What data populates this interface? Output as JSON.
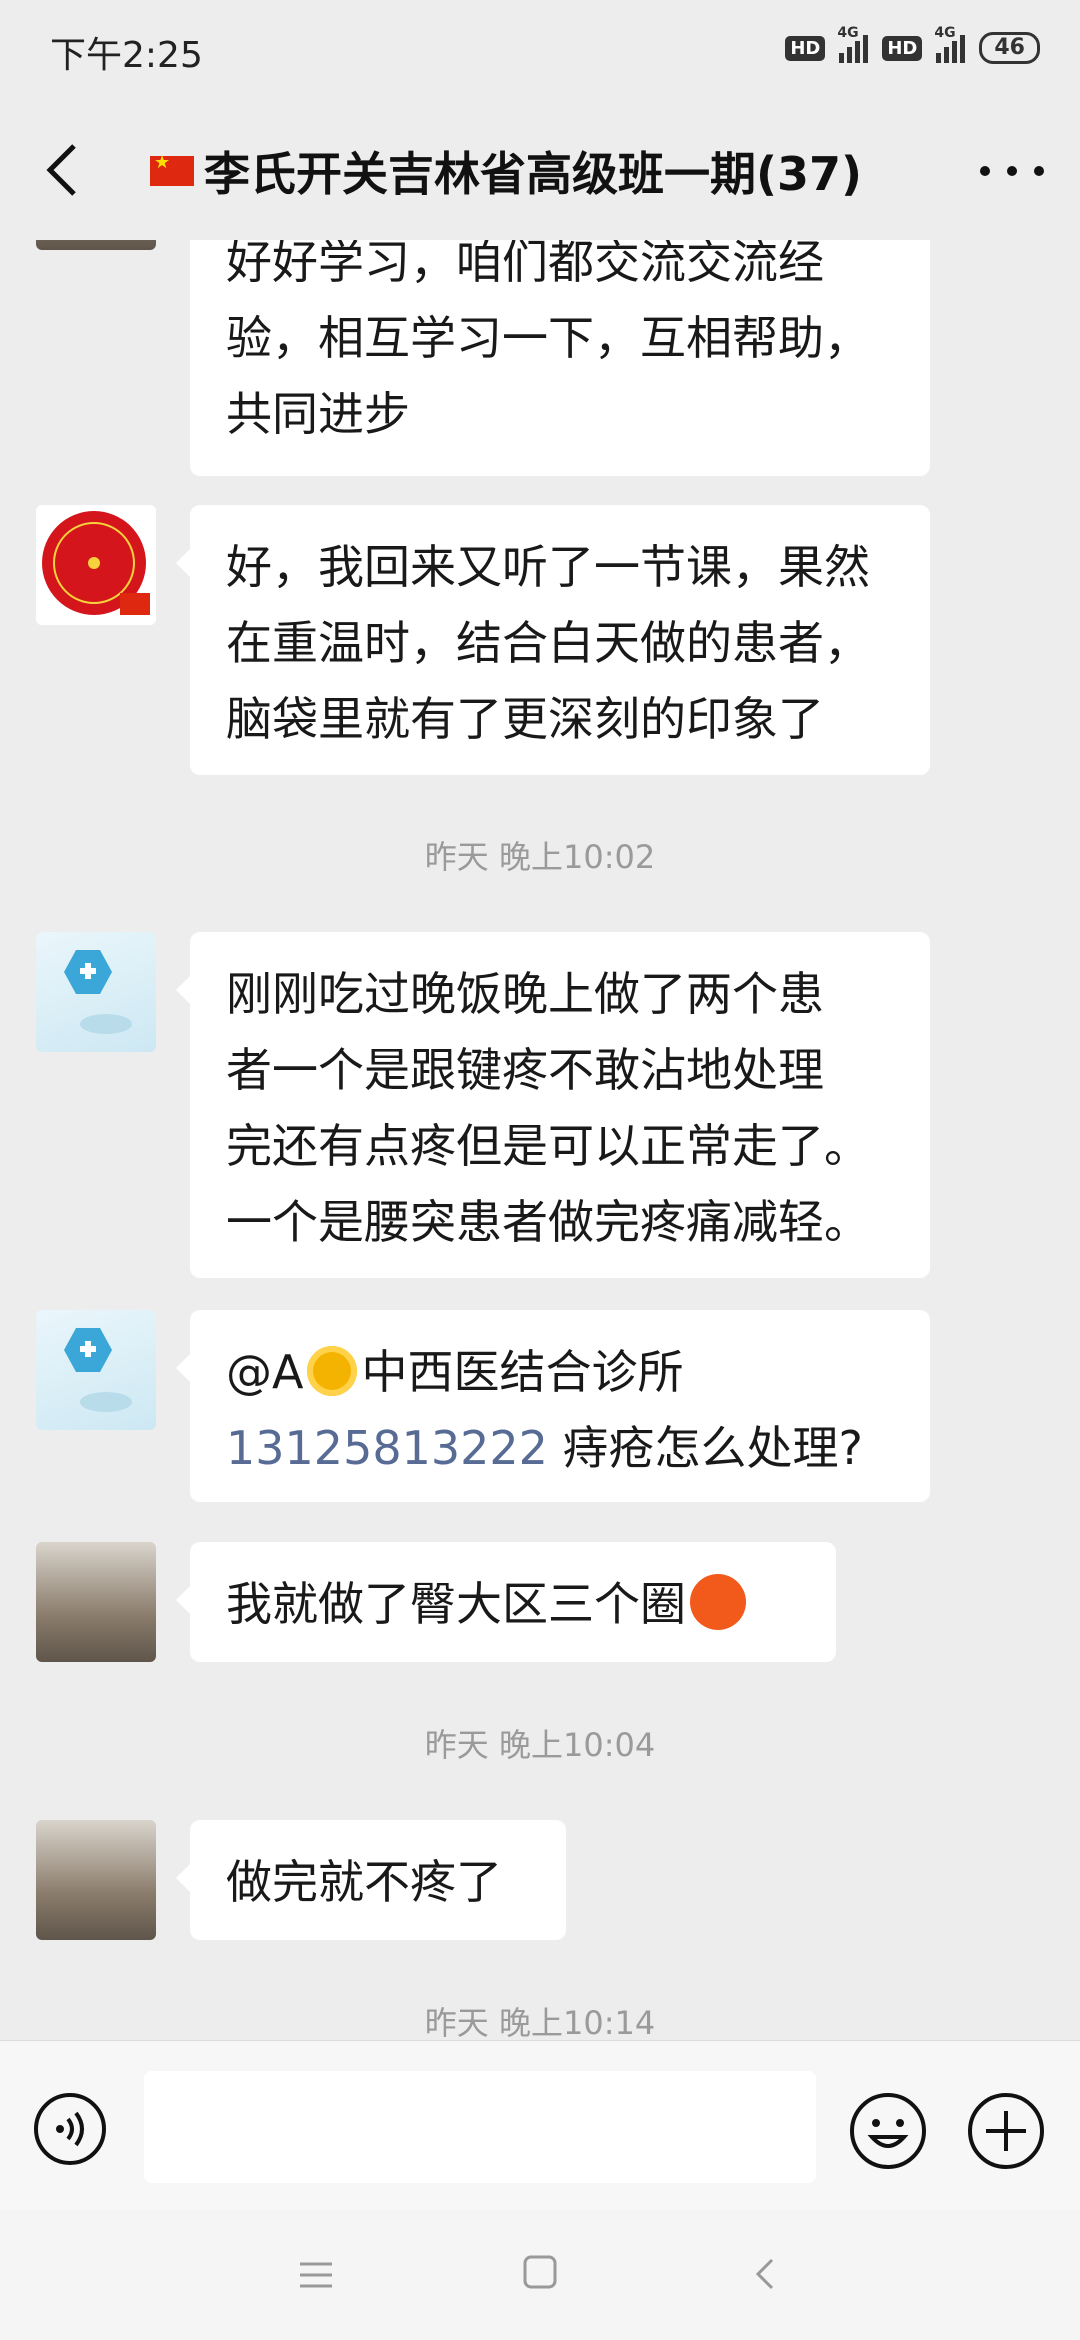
{
  "status_bar": {
    "time": "下午2:25",
    "hd1": "HD",
    "net1": "4G",
    "hd2": "HD",
    "net2": "4G",
    "battery": "46"
  },
  "header": {
    "title": "李氏开关吉林省高级班一期(37)"
  },
  "messages": [
    {
      "type": "text",
      "lines": [
        "好好学习，咱们都交流交流经",
        "验，相互学习一下，互相帮助，",
        "共同进步"
      ]
    },
    {
      "type": "text",
      "lines": [
        "好，我回来又听了一节课，果然",
        "在重温时，结合白天做的患者，",
        "脑袋里就有了更深刻的印象了"
      ]
    },
    {
      "type": "time",
      "text": "昨天 晚上10:02"
    },
    {
      "type": "text",
      "lines": [
        "刚刚吃过晚饭晚上做了两个患",
        "者一个是跟键疼不敢沾地处理",
        "完还有点疼但是可以正常走了。",
        "一个是腰突患者做完疼痛减轻。"
      ]
    },
    {
      "type": "text",
      "mention": "@A",
      "mention_rest": "中西医结合诊所",
      "phone": "13125813222",
      "tail": " 痔疮怎么处理?"
    },
    {
      "type": "text",
      "lines": [
        "我就做了臀大区三个圈"
      ]
    },
    {
      "type": "time",
      "text": "昨天 晚上10:04"
    },
    {
      "type": "text",
      "lines": [
        "做完就不疼了"
      ]
    },
    {
      "type": "time",
      "text": "昨天 晚上10:14"
    }
  ],
  "input": {
    "placeholder": ""
  },
  "icons": {
    "back": "chevron-left-icon",
    "more": "more-dots-icon",
    "voice": "voice-icon",
    "emoji": "emoji-icon",
    "plus": "plus-icon",
    "nav_menu": "menu-icon",
    "nav_home": "home-square-icon",
    "nav_back": "back-triangle-icon"
  },
  "colors": {
    "background": "#ededed",
    "bubble": "#ffffff",
    "link": "#576b95",
    "timestamp": "#9a9a9a"
  }
}
